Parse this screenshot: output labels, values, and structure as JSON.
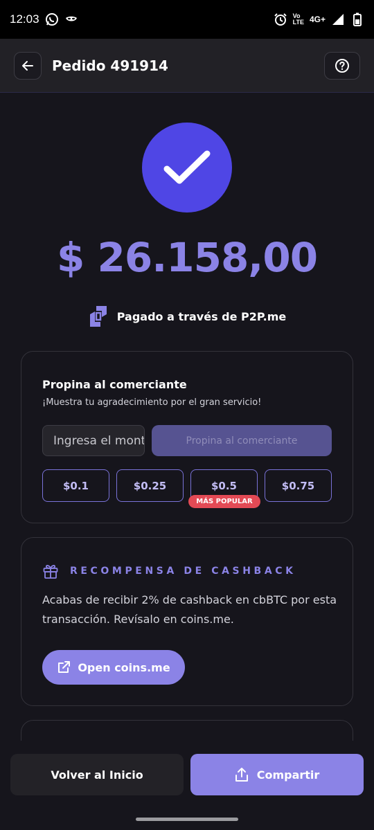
{
  "status_bar": {
    "time": "12:03",
    "left_icons": [
      "whatsapp-icon",
      "mask-icon"
    ],
    "volte_top": "Vo",
    "volte_bottom": "LTE",
    "network": "4G+",
    "right_icons": [
      "alarm-icon",
      "signal-icon",
      "battery-icon"
    ]
  },
  "header": {
    "title": "Pedido 491914",
    "back_icon": "arrow-left-icon",
    "help_icon": "question-circle-icon"
  },
  "success": {
    "icon": "checkmark-icon",
    "amount": "$ 26.158,00",
    "paid_via": "Pagado a través de P2P.me"
  },
  "tip": {
    "title": "Propina al comerciante",
    "subtitle": "¡Muestra tu agradecimiento por el gran servicio!",
    "input_placeholder": "Ingresa el monto",
    "submit_label": "Propina al comerciante",
    "presets": [
      "$0.1",
      "$0.25",
      "$0.5",
      "$0.75"
    ],
    "popular_badge": "MÁS POPULAR"
  },
  "cashback": {
    "title": "RECOMPENSA DE CASHBACK",
    "body": "Acabas de recibir 2% de cashback en cbBTC por esta transacción. Revísalo en coins.me.",
    "button_label": "Open coins.me"
  },
  "footer": {
    "home_label": "Volver al Inicio",
    "share_label": "Compartir"
  },
  "colors": {
    "accent": "#8b83e6",
    "success_circle": "#4f46e5",
    "background": "#16151c",
    "badge": "#e34a55"
  }
}
